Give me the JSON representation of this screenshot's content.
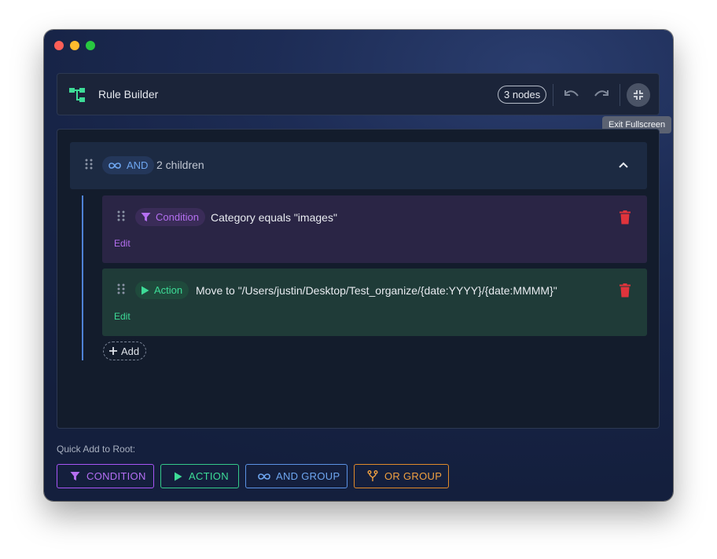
{
  "header": {
    "title": "Rule Builder",
    "nodes_chip": "3 nodes",
    "tooltip": "Exit Fullscreen"
  },
  "root_group": {
    "operator": "AND",
    "children_text": "2 children",
    "children": [
      {
        "type_label": "Condition",
        "description": "Category equals \"images\"",
        "edit_label": "Edit"
      },
      {
        "type_label": "Action",
        "description": "Move to \"/Users/justin/Desktop/Test_organize/{date:YYYY}/{date:MMMM}\"",
        "edit_label": "Edit"
      }
    ],
    "add_label": "Add"
  },
  "quick_add": {
    "label": "Quick Add to Root:",
    "buttons": {
      "condition": "CONDITION",
      "action": "ACTION",
      "and_group": "AND GROUP",
      "or_group": "OR GROUP"
    }
  },
  "colors": {
    "condition": "#b56ff5",
    "action": "#3ddc97",
    "and": "#6ea6f0",
    "or": "#f0a040",
    "delete": "#e0343c",
    "app_icon": "#3ddc97"
  },
  "icons": {
    "app": "tree-structure-icon",
    "undo": "undo-icon",
    "redo": "redo-icon",
    "exit_fullscreen": "exit-fullscreen-icon",
    "drag": "drag-handle-icon",
    "and": "infinity-icon",
    "condition": "filter-icon",
    "action": "play-icon",
    "delete": "trash-icon",
    "add": "plus-icon",
    "or": "fork-icon",
    "collapse": "chevron-up-icon"
  }
}
